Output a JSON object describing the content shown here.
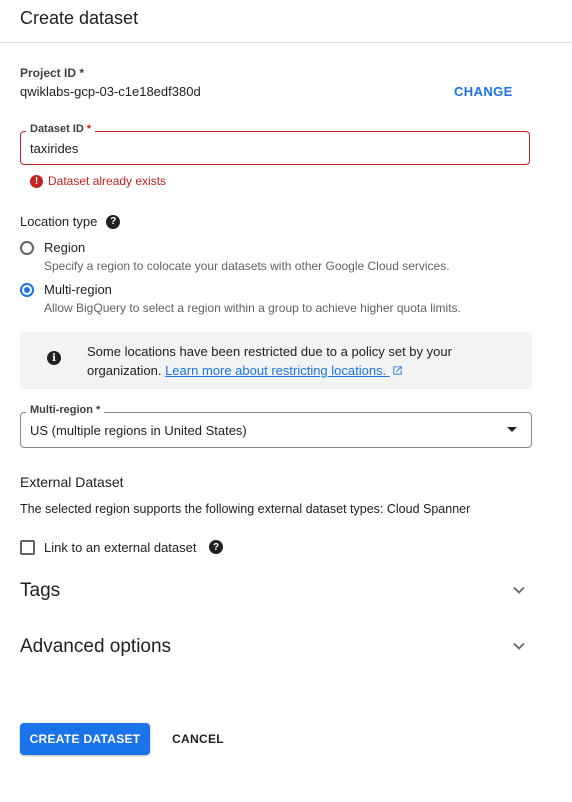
{
  "header": {
    "title": "Create dataset"
  },
  "project": {
    "label": "Project ID *",
    "value": "qwiklabs-gcp-03-c1e18edf380d",
    "change_label": "CHANGE"
  },
  "dataset": {
    "label": "Dataset ID",
    "required_mark": "*",
    "value": "taxirides",
    "error": "Dataset already exists"
  },
  "location": {
    "label": "Location type",
    "options": [
      {
        "label": "Region",
        "description": "Specify a region to colocate your datasets with other Google Cloud services.",
        "selected": false
      },
      {
        "label": "Multi-region",
        "description": "Allow BigQuery to select a region within a group to achieve higher quota limits.",
        "selected": true
      }
    ],
    "info_text": "Some locations have been restricted due to a policy set by your organization.",
    "info_link": "Learn more about restricting locations."
  },
  "multi_region": {
    "label": "Multi-region *",
    "value": "US (multiple regions in United States)"
  },
  "external": {
    "title": "External Dataset",
    "description": "The selected region supports the following external dataset types: Cloud Spanner",
    "checkbox_label": "Link to an external dataset",
    "checked": false
  },
  "sections": {
    "tags": "Tags",
    "advanced": "Advanced options"
  },
  "actions": {
    "create": "CREATE DATASET",
    "cancel": "CANCEL"
  },
  "colors": {
    "primary": "#1a73e8",
    "error": "#c5221f",
    "text": "#202124",
    "muted": "#5f6368"
  }
}
